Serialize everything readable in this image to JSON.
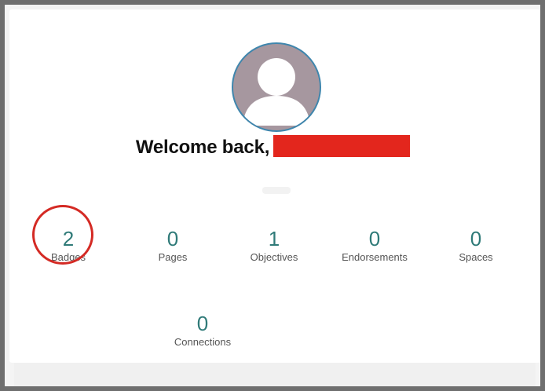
{
  "welcome": {
    "greeting": "Welcome back,"
  },
  "stats": [
    {
      "value": "2",
      "label": "Badges"
    },
    {
      "value": "0",
      "label": "Pages"
    },
    {
      "value": "1",
      "label": "Objectives"
    },
    {
      "value": "0",
      "label": "Endorsements"
    },
    {
      "value": "0",
      "label": "Spaces"
    },
    {
      "value": "0",
      "label": "Connections"
    }
  ],
  "colors": {
    "stat_number": "#2f7a78",
    "highlight": "#d42a24",
    "redaction": "#e3261d",
    "avatar_border": "#3f86ad",
    "avatar_bg": "#a6979f"
  },
  "icons": {
    "avatar": "user-silhouette-icon"
  }
}
